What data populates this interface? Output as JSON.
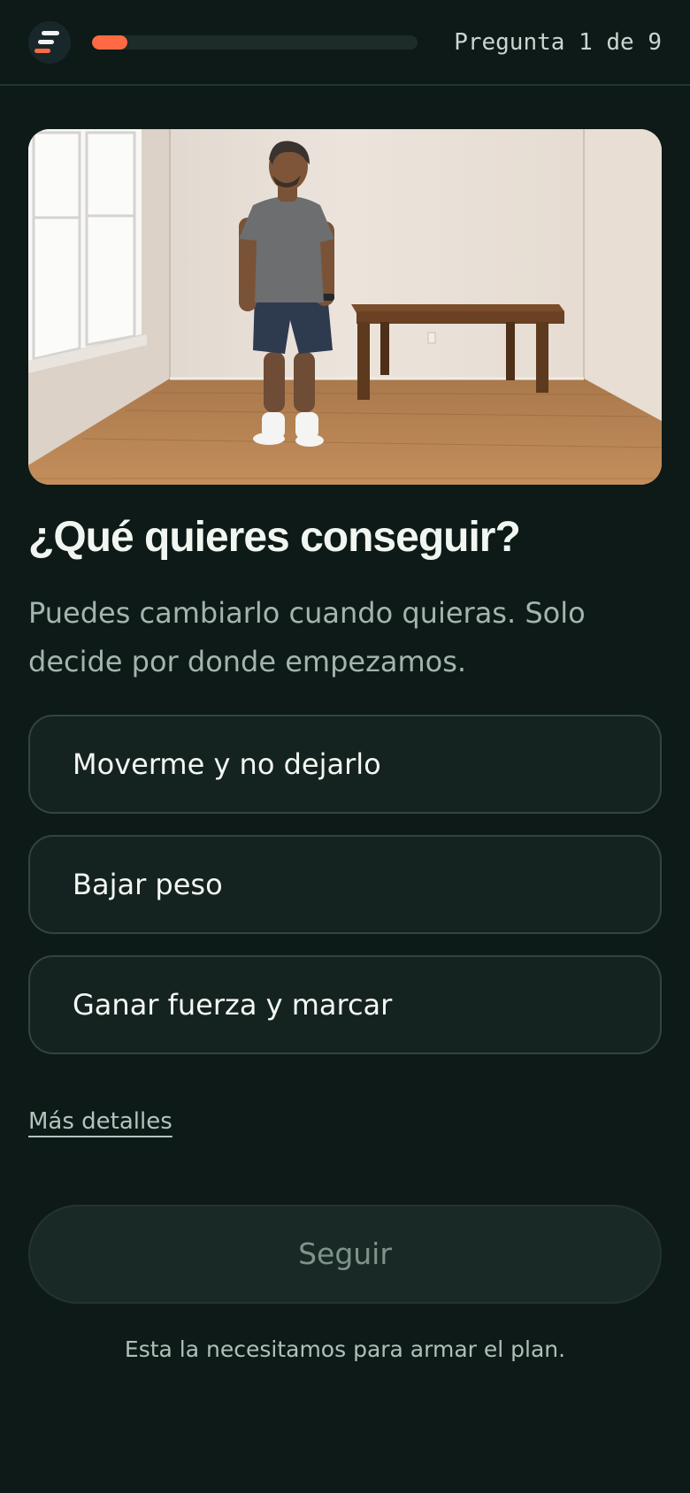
{
  "header": {
    "logo_icon": "app-logo-icon",
    "progress": {
      "current": 1,
      "total": 9,
      "fraction": 0.11
    },
    "step_label": "Pregunta 1 de 9"
  },
  "hero": {
    "icon": "hero-photo"
  },
  "question": {
    "title": "¿Qué quieres conseguir?",
    "subtitle": "Puedes cambiarlo cuando quieras. Solo decide por donde empezamos."
  },
  "options": [
    {
      "label": "Moverme y no dejarlo"
    },
    {
      "label": "Bajar peso"
    },
    {
      "label": "Ganar fuerza y marcar"
    }
  ],
  "more_link": "Más detalles",
  "continue_button": "Seguir",
  "footnote": "Esta la necesitamos para armar el plan.",
  "colors": {
    "background": "#0d1a18",
    "accent": "#ff6a45",
    "progress_track": "#1d2b29",
    "option_border": "#33443f",
    "button_disabled_text": "#7f938a"
  }
}
